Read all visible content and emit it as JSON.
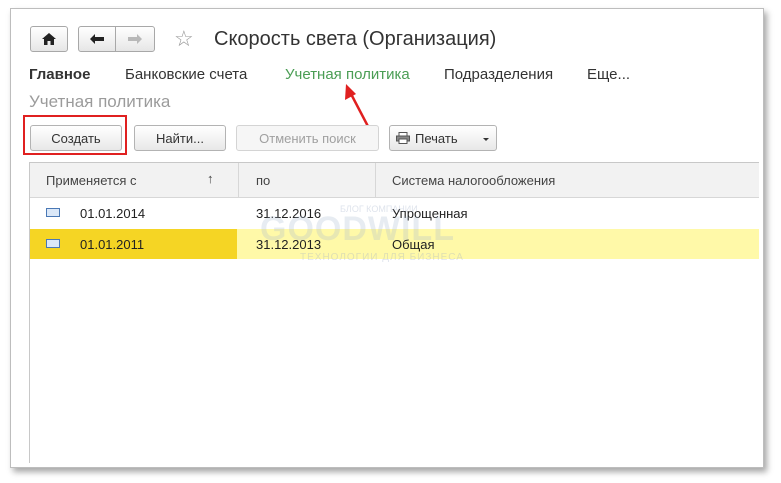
{
  "window": {
    "title": "Скорость света (Организация)"
  },
  "nav": {
    "home_icon": "home-icon",
    "back_icon": "arrow-left-icon",
    "forward_icon": "arrow-right-icon",
    "favorite_icon": "star-icon"
  },
  "tabs": [
    {
      "label": "Главное"
    },
    {
      "label": "Банковские счета"
    },
    {
      "label": "Учетная политика"
    },
    {
      "label": "Подразделения"
    },
    {
      "label": "Еще..."
    }
  ],
  "section_title": "Учетная политика",
  "toolbar": {
    "create_label": "Создать",
    "find_label": "Найти...",
    "cancel_search_label": "Отменить поиск",
    "print_label": "Печать",
    "print_icon": "printer-icon",
    "dropdown_icon": "chevron-down-icon"
  },
  "table": {
    "columns": [
      "Применяется с",
      "по",
      "Система налогообложения"
    ],
    "sort_icon": "arrow-up-icon",
    "rows": [
      {
        "from": "01.01.2014",
        "to": "31.12.2016",
        "system": "Упрощенная"
      },
      {
        "from": "01.01.2011",
        "to": "31.12.2013",
        "system": "Общая"
      }
    ]
  },
  "watermark": {
    "top": "БЛОГ КОМПАНИИ",
    "main": "GOODWILL",
    "sub": "ТЕХНОЛОГИИ ДЛЯ БИЗНЕСА"
  },
  "colors": {
    "accent_green": "#4a9d54",
    "highlight_red": "#e02020",
    "selected_row": "#f5d524"
  }
}
